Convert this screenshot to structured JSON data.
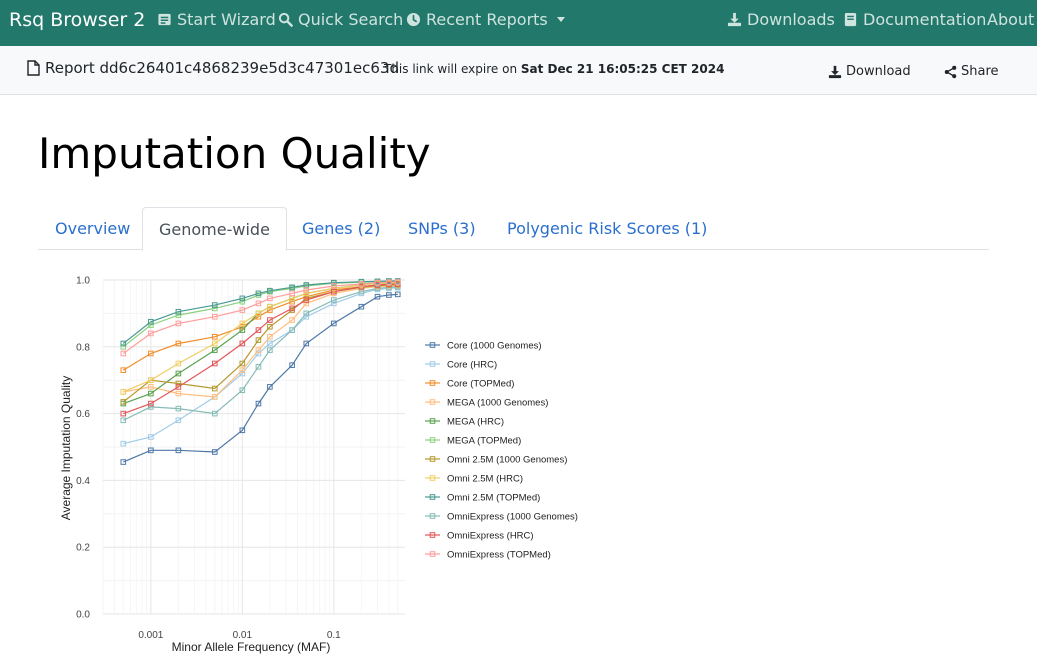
{
  "navbar": {
    "brand": "Rsq Browser 2",
    "items": [
      {
        "label": "Start Wizard",
        "icon": "wizard-icon"
      },
      {
        "label": "Quick Search",
        "icon": "search-icon"
      },
      {
        "label": "Recent Reports",
        "icon": "clock-icon"
      },
      {
        "label": "Downloads",
        "icon": "download-icon"
      },
      {
        "label": "Documentation",
        "icon": "book-icon"
      },
      {
        "label": "About",
        "icon": ""
      }
    ]
  },
  "subbar": {
    "report_label": "Report dd6c26401c4868239e5d3c47301ec63d",
    "expire_prefix": "This link will expire on",
    "expire_date": "Sat Dec 21 16:05:25 CET 2024",
    "download_label": "Download",
    "share_label": "Share"
  },
  "page": {
    "title": "Imputation Quality"
  },
  "tabs": [
    {
      "label": "Overview",
      "active": false
    },
    {
      "label": "Genome-wide",
      "active": true
    },
    {
      "label": "Genes (2)",
      "active": false
    },
    {
      "label": "SNPs (3)",
      "active": false
    },
    {
      "label": "Polygenic Risk Scores (1)",
      "active": false
    }
  ],
  "chart_data": {
    "type": "line",
    "xlabel": "Minor Allele Frequency (MAF)",
    "ylabel": "Average Imputation Quality",
    "x_scale": "log",
    "xlim": [
      0.0003,
      0.6
    ],
    "ylim": [
      0,
      1.0
    ],
    "x_ticks": [
      {
        "value": 0.001,
        "label": "0.001"
      },
      {
        "value": 0.01,
        "label": "0.01"
      },
      {
        "value": 0.1,
        "label": "0.1"
      }
    ],
    "y_ticks": [
      {
        "value": 0.0,
        "label": "0.0"
      },
      {
        "value": 0.2,
        "label": "0.2"
      },
      {
        "value": 0.4,
        "label": "0.4"
      },
      {
        "value": 0.6,
        "label": "0.6"
      },
      {
        "value": 0.8,
        "label": "0.8"
      },
      {
        "value": 1.0,
        "label": "1.0"
      }
    ],
    "grid": true,
    "legend_position": "right",
    "x": [
      0.0005,
      0.001,
      0.002,
      0.005,
      0.01,
      0.015,
      0.02,
      0.035,
      0.05,
      0.1,
      0.2,
      0.3,
      0.4,
      0.5
    ],
    "series": [
      {
        "name": "Core (1000 Genomes)",
        "color": "#4e79a7",
        "values": [
          0.455,
          0.49,
          0.49,
          0.485,
          0.55,
          0.63,
          0.68,
          0.745,
          0.81,
          0.87,
          0.92,
          0.95,
          0.955,
          0.957
        ]
      },
      {
        "name": "Core (HRC)",
        "color": "#a0cbe8",
        "values": [
          0.51,
          0.53,
          0.58,
          0.65,
          0.72,
          0.78,
          0.81,
          0.85,
          0.89,
          0.93,
          0.96,
          0.972,
          0.975,
          0.977
        ]
      },
      {
        "name": "Core (TOPMed)",
        "color": "#f28e2b",
        "values": [
          0.73,
          0.78,
          0.81,
          0.83,
          0.86,
          0.89,
          0.91,
          0.935,
          0.95,
          0.97,
          0.98,
          0.985,
          0.987,
          0.988
        ]
      },
      {
        "name": "MEGA (1000 Genomes)",
        "color": "#ffbe7d",
        "values": [
          0.665,
          0.68,
          0.66,
          0.65,
          0.73,
          0.79,
          0.83,
          0.88,
          0.93,
          0.96,
          0.975,
          0.98,
          0.982,
          0.983
        ]
      },
      {
        "name": "MEGA (HRC)",
        "color": "#59a14f",
        "values": [
          0.63,
          0.66,
          0.72,
          0.79,
          0.85,
          0.9,
          0.92,
          0.945,
          0.96,
          0.975,
          0.985,
          0.99,
          0.99,
          0.991
        ]
      },
      {
        "name": "MEGA (TOPMed)",
        "color": "#8cd17d",
        "values": [
          0.8,
          0.865,
          0.895,
          0.915,
          0.935,
          0.955,
          0.965,
          0.975,
          0.982,
          0.99,
          0.993,
          0.995,
          0.996,
          0.996
        ]
      },
      {
        "name": "Omni 2.5M (1000 Genomes)",
        "color": "#b6992d",
        "values": [
          0.635,
          0.7,
          0.69,
          0.675,
          0.75,
          0.82,
          0.86,
          0.91,
          0.945,
          0.965,
          0.978,
          0.983,
          0.985,
          0.986
        ]
      },
      {
        "name": "Omni 2.5M (HRC)",
        "color": "#f1ce63",
        "values": [
          0.665,
          0.7,
          0.75,
          0.81,
          0.87,
          0.9,
          0.92,
          0.945,
          0.96,
          0.975,
          0.985,
          0.99,
          0.99,
          0.991
        ]
      },
      {
        "name": "Omni 2.5M (TOPMed)",
        "color": "#499894",
        "values": [
          0.81,
          0.875,
          0.905,
          0.925,
          0.945,
          0.96,
          0.968,
          0.978,
          0.985,
          0.992,
          0.995,
          0.996,
          0.997,
          0.997
        ]
      },
      {
        "name": "OmniExpress (1000 Genomes)",
        "color": "#86bcb6",
        "values": [
          0.58,
          0.62,
          0.615,
          0.6,
          0.67,
          0.74,
          0.79,
          0.85,
          0.9,
          0.94,
          0.965,
          0.975,
          0.978,
          0.98
        ]
      },
      {
        "name": "OmniExpress (HRC)",
        "color": "#e15759",
        "values": [
          0.6,
          0.63,
          0.68,
          0.75,
          0.81,
          0.85,
          0.88,
          0.915,
          0.94,
          0.965,
          0.98,
          0.985,
          0.987,
          0.988
        ]
      },
      {
        "name": "OmniExpress (TOPMed)",
        "color": "#ff9d9a",
        "values": [
          0.78,
          0.84,
          0.87,
          0.89,
          0.91,
          0.93,
          0.945,
          0.96,
          0.97,
          0.982,
          0.988,
          0.992,
          0.993,
          0.994
        ]
      }
    ]
  }
}
